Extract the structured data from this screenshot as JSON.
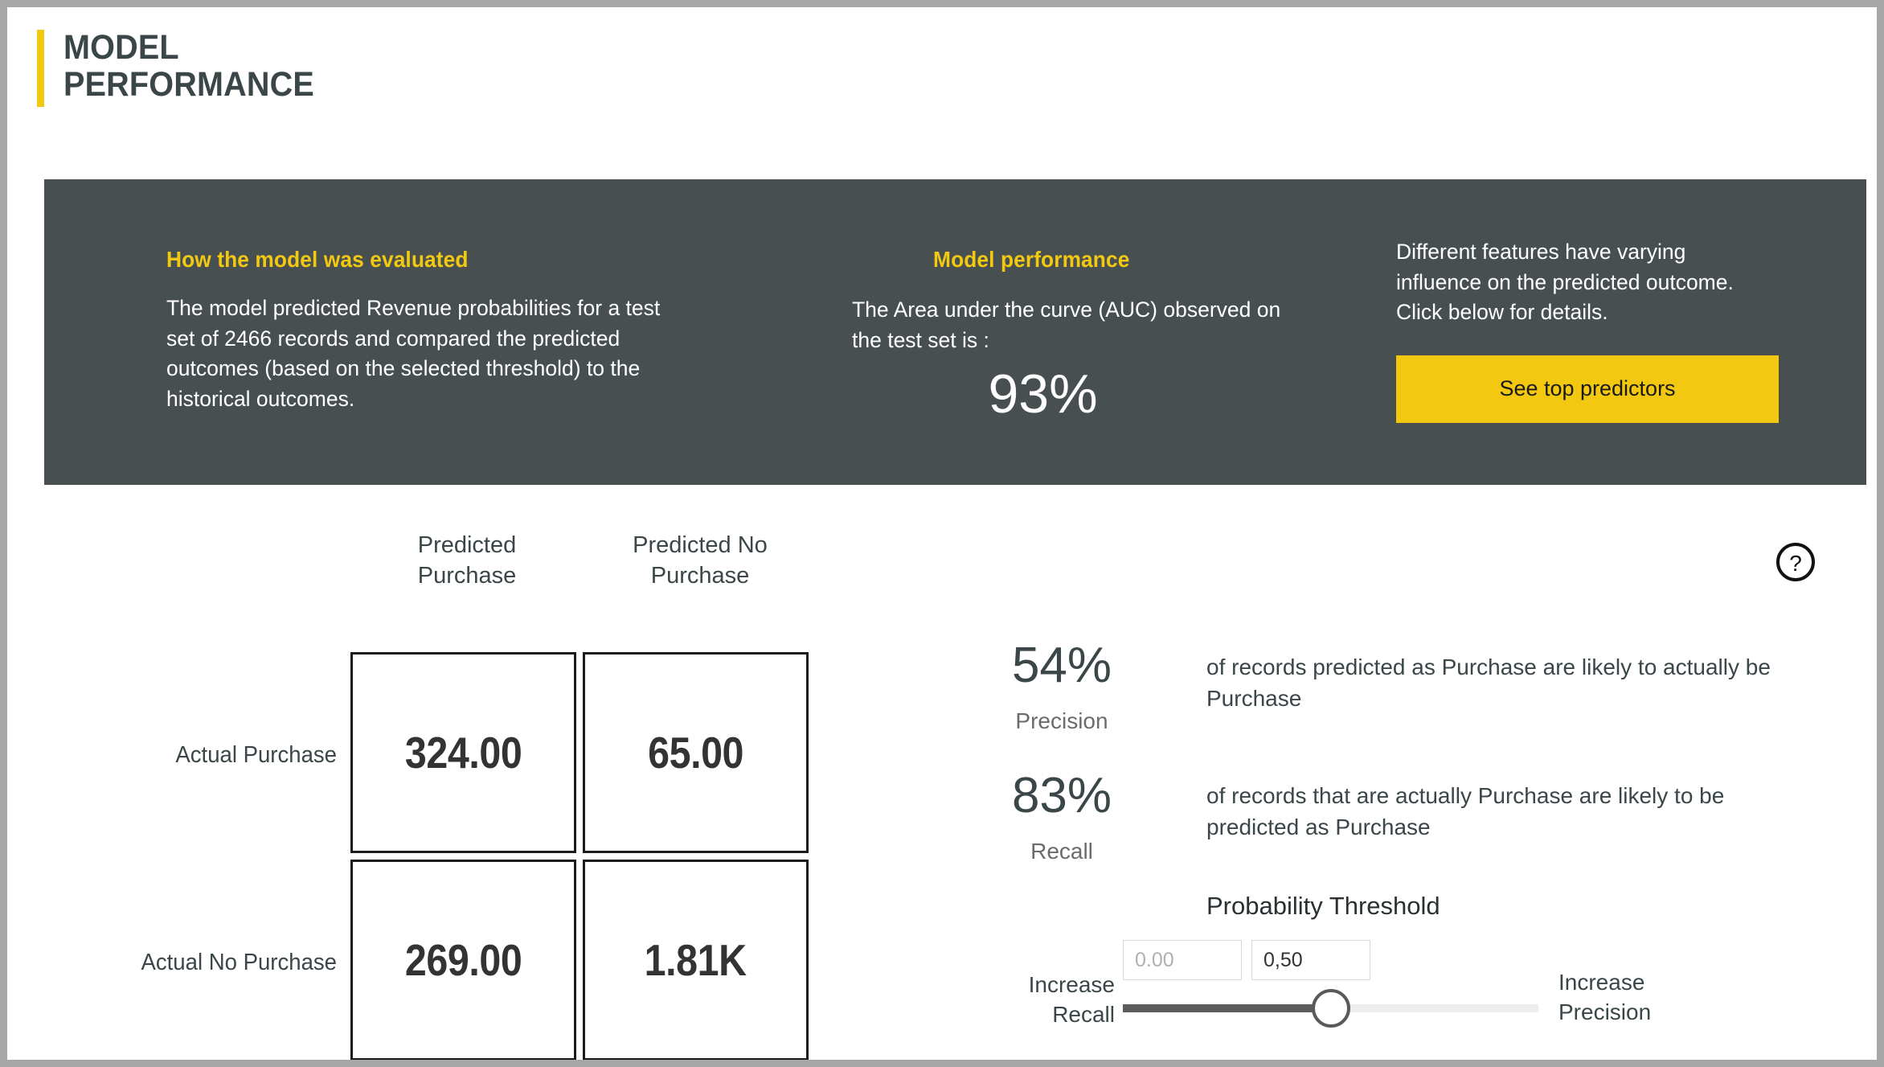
{
  "header": {
    "title": "MODEL\nPERFORMANCE",
    "accent_color": "#f2c811"
  },
  "panel": {
    "background_color": "#474f51",
    "evaluation": {
      "heading": "How the model was evaluated",
      "body": "The model predicted Revenue probabilities for a test set of 2466 records and compared the predicted outcomes (based on the selected threshold) to the historical outcomes."
    },
    "performance": {
      "heading": "Model performance",
      "body": "The Area under the curve (AUC) observed on the test set is :",
      "auc_value": "93%"
    },
    "features": {
      "body": "Different features have varying influence on the predicted outcome.  Click below for details.",
      "button_label": "See top predictors"
    }
  },
  "help": {
    "icon": "question-circle-icon",
    "glyph": "?"
  },
  "confusion_matrix": {
    "column_headers": [
      "Predicted\nPurchase",
      "Predicted No\nPurchase"
    ],
    "row_headers": [
      "Actual Purchase",
      "Actual No Purchase"
    ],
    "cells": [
      [
        "324.00",
        "65.00"
      ],
      [
        "269.00",
        "1.81K"
      ]
    ]
  },
  "metrics": [
    {
      "value": "54%",
      "label": "Precision",
      "description": "of records predicted as Purchase are likely to actually be Purchase"
    },
    {
      "value": "83%",
      "label": "Recall",
      "description": "of records that are actually Purchase are likely to be predicted as Purchase"
    }
  ],
  "threshold": {
    "title": "Probability Threshold",
    "min_value": "0.00",
    "max_value": "0,50",
    "slider_position_percent": 50,
    "left_caption": "Increase\nRecall",
    "right_caption": "Increase\nPrecision"
  },
  "chart_data": {
    "type": "table",
    "title": "Confusion Matrix",
    "categories": [
      "Predicted Purchase",
      "Predicted No Purchase"
    ],
    "rows": [
      "Actual Purchase",
      "Actual No Purchase"
    ],
    "values": [
      [
        324,
        65
      ],
      [
        269,
        1810
      ]
    ],
    "metrics": {
      "auc": 0.93,
      "precision": 0.54,
      "recall": 0.83,
      "threshold": 0.5,
      "test_set_records": 2466
    }
  }
}
